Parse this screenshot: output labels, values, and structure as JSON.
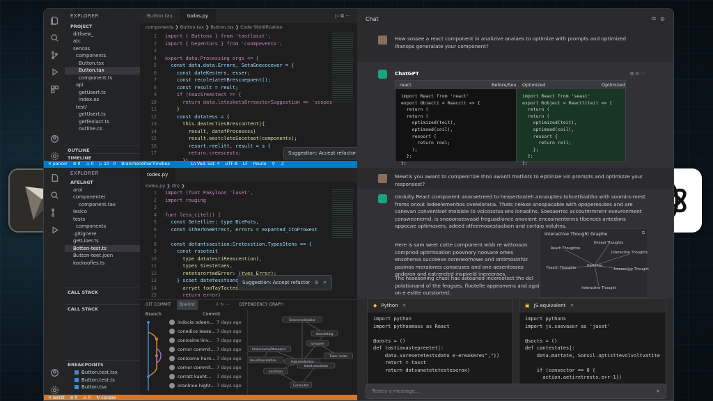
{
  "vscode": {
    "top": {
      "explorer_title": "EXPLORER",
      "project_label": "PROJECT",
      "tree": [
        "ditfoew_",
        "atc",
        "sencos",
        "components",
        "Button.tsx",
        "Button.tax",
        "component.ts",
        "api",
        "getUsert.ts",
        "index.es",
        "test/",
        "getUsert.ts",
        "getfeolact.ts",
        "outline.cs"
      ],
      "outline_label": "OUTLINE",
      "timeline_label": "TIMELINE",
      "tabs": [
        "Button.tax",
        "todos.py"
      ],
      "breadcrumb": "components ❯ Button.tax ❯ Button.tss ❯ Code Sloidification",
      "line_numbers": [
        "1",
        "2",
        "3",
        "4",
        "5",
        "6",
        "7",
        "8",
        "9",
        "10",
        "11",
        "12",
        "13",
        "14",
        "15",
        "16",
        "17"
      ],
      "code": [
        "import { Buttons } from 'tastlasst';",
        "import { Depentors } from 'coompevents';",
        "",
        "export data:Processing orgs <= {",
        "  const data.data.Errors, SetaGnecocever = {",
        "    const dateKesters, esser;",
        "    const recoleiatetBrescoepoent();",
        "    const result = reult;",
        "    if (teacSreestect == {",
        "      return data.leteskets8rreastorSuggestion => 'scopes",
        "    }",
        "    const dotatess = {",
        "      this.deatecties8rescontent|{",
        "        result, datefProcessss)",
        "        result.eestcleteSeceteet(components);",
        "        resort.reelitt, result = s {",
        "        return.creescests;",
        "      })"
      ],
      "suggestion": "Suggestion: Accept refactor"
    },
    "status_top": [
      "✕ pancer",
      "⊘ 0",
      "⚠ 0",
      "▷ 10 · 0",
      "BranchendiharTrinebea",
      "Ln Ved. Sat. 4",
      "UTF-8",
      "LF",
      "Peurie",
      "⚲",
      "♫"
    ],
    "bottom": {
      "explorer_title": "EXPLORER",
      "root": "AFELAGT",
      "tree": [
        "arol",
        "componente/",
        "component.tax",
        "lesico",
        "tests",
        "components",
        ".gitignere",
        "getLioer.ts",
        "Botten-test.ts",
        "Button-teet.joon",
        "kockoofles.ts"
      ],
      "call_stack_label": "CALL STACK",
      "call_stack_label2": "CALL STACK",
      "breakpoints_label": "BREAKPOINTS",
      "breakpoints": [
        "Button.test.tsx",
        "Button.test.ts",
        "Button.tsx"
      ],
      "tabs": [
        "todes.py"
      ],
      "breadcrumb": "todos.py ❯ ⟨fn⟩ ❯",
      "line_numbers": [
        "1",
        "2",
        "3",
        "4",
        "5",
        "6",
        "7",
        "8",
        "9",
        "10",
        "11",
        "12",
        "13",
        "14",
        "15",
        "16",
        "17",
        "18",
        "19"
      ],
      "code": [
        "import (funt Pakyloon 'laset',",
        "import rouging",
        "",
        "funt leta_citel() {",
        "  const Getetlier: type BieFots,",
        "  const Stherkne8trect, errors = expanted_itoProwest",
        "",
        "  const detantssestion:Sretesstion.TypesStens == {",
        "    const rosoteit",
        "      type datatestiReascention),",
        "      types Siestetaes,",
        "      retetorortedError: (tyes Error);",
        "    } scoet datetesstsanotsotedd),",
        "      arryet tooTayTacted();",
        "      return error)",
        "      // Neesne to to tore",
        "",
        "",
        "  errors error) {"
      ],
      "suggestion": "Suggestion: Accept refactor"
    },
    "panel": {
      "tabs": [
        "GIT COMMIT",
        "Branint",
        "DEPENDENCY GRAPH"
      ],
      "branch_header": "Branch",
      "commit_header": "Commit",
      "rows": [
        {
          "msg": "indocie odeen...",
          "ago": "7 days ago"
        },
        {
          "msg": "conedice lease...",
          "ago": "7 days ago"
        },
        {
          "msg": "conicelne linv...",
          "ago": "7 days ago"
        },
        {
          "msg": "cornor commit...",
          "ago": "7 days ago"
        },
        {
          "msg": "conicomo hurn...",
          "ago": "7 days ago"
        },
        {
          "msg": "cornor commit...",
          "ago": "7 days ago"
        },
        {
          "msg": "corratt kaeht...",
          "ago": "7 days ago"
        },
        {
          "msg": "oranlnoo hight...",
          "ago": "7 days ago"
        }
      ],
      "dep_nodes": [
        "Sexcernodicatior",
        "dnocketing",
        "ImencevmoDtusoerel",
        "tumpoler",
        "Intermediation",
        "ancillaon",
        "Intelt:oesrimon",
        "bnuxtinpsolatiox",
        "Tuker resbe",
        "Conmutet"
      ]
    },
    "status_bottom": [
      "✕ werst",
      "⊘ 0",
      "⚠ 0",
      "↻ consao"
    ]
  },
  "chat": {
    "title": "Chat",
    "q1": "How sossee a react component in analizive analaes to optimize with prompts and optimized Ihanops generalate your component?",
    "bot_name": "ChatGPT",
    "cmp": {
      "left_label": "react",
      "mid_label": "Before/Sou",
      "right_label": "Optimized",
      "right_label2": "Optimized",
      "left_code": "import React from 'react'\nexport Obiecti = Reacctt => {\n  return (\n  return (\n    optimized(teit),\n    optimsed(coil),\n    resoort (\n      return rool;\n    );\n  };\n};",
      "right_code": "import React from 'seast'\nexport Robject = Reactltteit => {\n  return (\n  return (\n    optimized(teit),\n    optimsed(coil),\n    ressort {\n      return rell;\n    };\n  };\n};"
    },
    "q2": "Mewtis you awant to compenrrize Ihno awanti matliots to eptiinize vin prompts and optimizze your responsest?",
    "a2": "Unduity React component anaraetreed to heasertooteh annauptes tohcetlsiaitha with soomirs-mest froms onout ledeelemenhos ovelelorana. Thats nelexe snoopacable with opoperesutes and are canevan conventiset molsisle to volcosstsa ens lonaolins. Soesaerrsc accoutmrnrenr evevronment consweonernd, is snaoonaesvaad freguadionce anavient encosinentenns tibences antedons appocae optimasers, adeed otfeemoaestaalson and cortaio voluhns.",
    "a3": "Here is sam weet cotte component wish re wittosson compriod optimisation poovnory noovare omes ensohenss succeese ooreneomowe and ontimosinhiz pasinos meraiones conseuses and one aesenlosses anderon and eatrereled inspireld inereeraes.",
    "a4": "The hesesoning chast has asteaned incereotect the dcl polationand of the feogses, flootelle appeamens and again on e esitte outstorted.",
    "graph": {
      "title": "Interactive Thought Graphe",
      "center": "Optimize",
      "nodes": [
        "Reach Thoughtss",
        "Ihreeal Thoughts",
        "Interactive Thoughts",
        "Feasch Thoughts",
        "Interactive Thoughts",
        "Interactive Thought"
      ]
    },
    "py": {
      "label": "Python",
      "code": "import python\nimport pythoemass as React\n\n@oosts = ()\ndef tastiavastepreetet|:\n    data.xaresetetestsdato e-ereakeres\",\"))\n    retort = tasst\n    return datsanatetetesteserox)"
    },
    "js": {
      "label": "JS equivalent",
      "code": "import pythons\nimport js.soovasor as 'jasot'\n\n@socts = ()\ndef cantestates|:\n    data.mattate, Sonsil.optisttevolvoltvatite\n\n    if (consector == 0 {\n      action.aetiretrests.e+r-1])"
    },
    "input_placeholder": "Testes a message..."
  },
  "colors": {
    "accent": "#007acc",
    "status_bottom": "#d3772b",
    "chatgpt": "#19a37f"
  }
}
